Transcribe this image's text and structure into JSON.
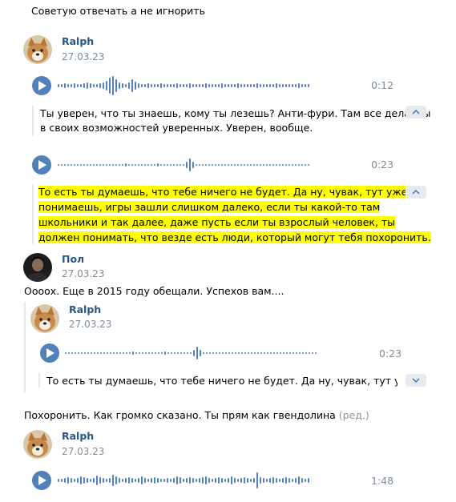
{
  "top_message": {
    "text": "Советую отвечать а не игнорить"
  },
  "post1": {
    "author": "Ralph",
    "date": "27.03.23",
    "voice1": {
      "duration": "0:12"
    },
    "transcript1": [
      "Ты уверен, что ты знаешь, кому ты лезешь? Анти-фури. Там все дела. Ты",
      "в своих возможностей уверенных. Уверен, вообще."
    ],
    "voice2": {
      "duration": "0:23"
    },
    "transcript2": [
      "То есть ты думаешь, что тебе ничего не будет. Да ну, чувак, тут уже",
      "понимаешь, игры зашли слишком далеко, если ты какой-то там",
      "школьники и так далее, даже пусть если ты взрослый человек, ты",
      "должен понимать, что везде есть люди, который могут тебя похоронить."
    ]
  },
  "post2": {
    "author": "Пол",
    "date": "27.03.23",
    "text": "Оооох. Еще в 2015 году обещали. Успехов вам....",
    "quoted": {
      "author": "Ralph",
      "date": "27.03.23",
      "voice": {
        "duration": "0:23"
      },
      "transcript": "То есть ты думаешь, что тебе ничего не будет. Да ну, чувак, тут уже пони"
    }
  },
  "post3": {
    "text": "Похоронить. Как громко сказано. Ты прям как гвендолина",
    "edited": "(ред.)"
  },
  "post4": {
    "author": "Ralph",
    "date": "27.03.23",
    "voice": {
      "duration": "1:48"
    }
  },
  "colors": {
    "accent": "#5181b8",
    "name": "#2a5885",
    "muted": "#818c99",
    "highlight": "#ffff00"
  },
  "icons": {
    "play": "play-icon",
    "collapse": "chevron-up-icon",
    "expand": "chevron-down-icon"
  }
}
